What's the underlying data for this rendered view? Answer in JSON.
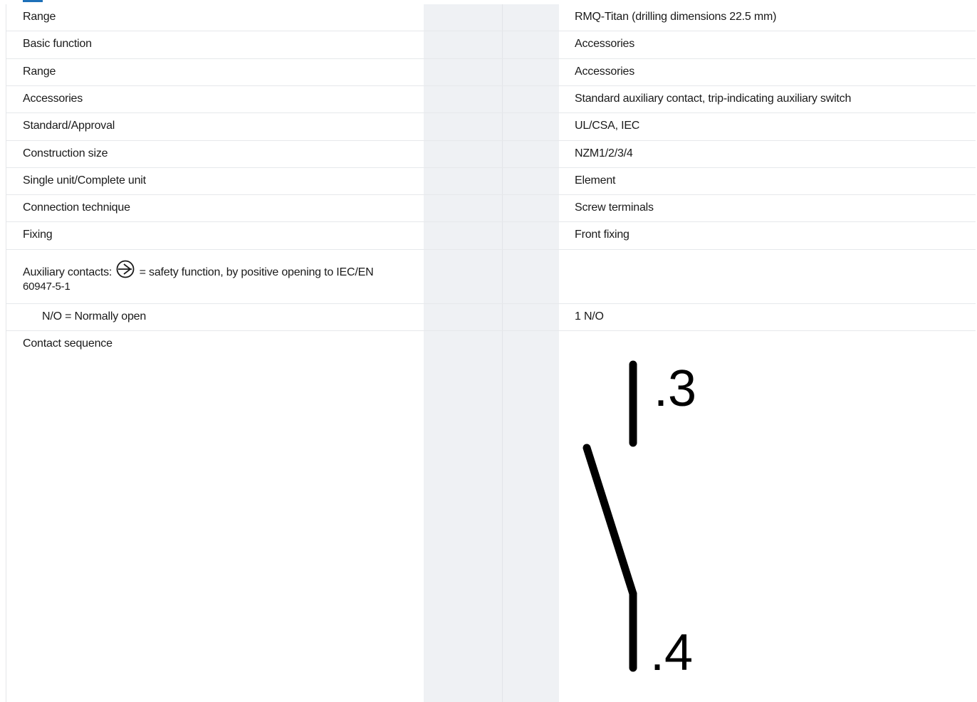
{
  "rows": [
    {
      "label": "Range",
      "value": "RMQ-Titan (drilling dimensions 22.5 mm)"
    },
    {
      "label": "Basic function",
      "value": "Accessories"
    },
    {
      "label": "Range",
      "value": "Accessories"
    },
    {
      "label": "Accessories",
      "value": "Standard auxiliary contact, trip-indicating auxiliary switch"
    },
    {
      "label": "Standard/Approval",
      "value": "UL/CSA, IEC"
    },
    {
      "label": "Construction size",
      "value": "NZM1/2/3/4"
    },
    {
      "label": "Single unit/Complete unit",
      "value": "Element"
    },
    {
      "label": "Connection technique",
      "value": "Screw terminals"
    },
    {
      "label": "Fixing",
      "value": "Front fixing"
    }
  ],
  "aux_contacts": {
    "label_prefix": "Auxiliary contacts:",
    "label_suffix": "= safety function, by positive opening to IEC/EN",
    "label_line2": "60947-5-1",
    "icon": "positive-opening-icon",
    "value": ""
  },
  "no_row": {
    "label": "N/O = Normally open",
    "value": "1 N/O"
  },
  "contact_sequence": {
    "label": "Contact sequence",
    "diagram": {
      "top_terminal": ".3",
      "bottom_terminal": ".4",
      "icon": "normally-open-contact-symbol"
    }
  }
}
